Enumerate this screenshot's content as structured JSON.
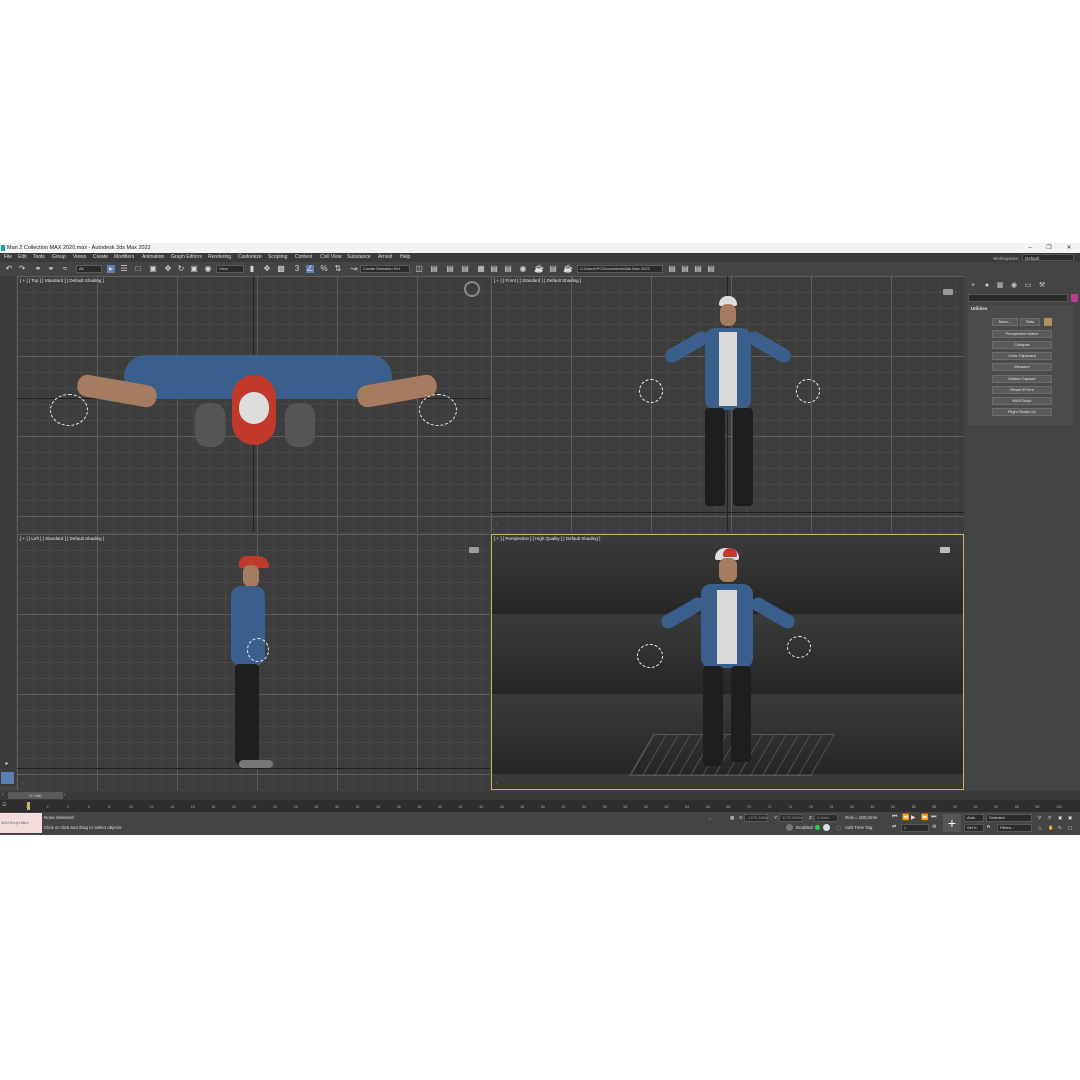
{
  "window": {
    "title": "Man 2 Collection MAX 2020.max - Autodesk 3ds Max 2022"
  },
  "menu": {
    "items": [
      "File",
      "Edit",
      "Tools",
      "Group",
      "Views",
      "Create",
      "Modifiers",
      "Animation",
      "Graph Editors",
      "Rendering",
      "Customize",
      "Scripting",
      "Content",
      "Civil View",
      "Substance",
      "Arnold",
      "Help"
    ]
  },
  "workspace": {
    "label": "Workspaces:",
    "value": "Default"
  },
  "toolbar": {
    "filter_value": "All",
    "refcoord_value": "View",
    "selection_set_placeholder": "Create Selection Set",
    "project_path": "C:\\Users\\PC\\Documents\\3ds Max 2022"
  },
  "viewports": {
    "top": {
      "label": "[ + ] [ Top ] [ Standard ] [ Default Shading ]"
    },
    "front": {
      "label": "[ + ] [ Front ] [ Standard ] [ Default Shading ]"
    },
    "left": {
      "label": "[ + ] [ Left ] [ Standard ] [ Default Shading ]"
    },
    "perspective": {
      "label": "[ + ] [ Perspective ] [ High Quality ] [ Default Shading ]"
    }
  },
  "command_panel": {
    "rollout_title": "Utilities",
    "more_button": "More...",
    "sets_button": "Sets",
    "utilities": [
      "Perspective Match",
      "Collapse",
      "Color Clipboard",
      "Measure",
      "Motion Capture",
      "Reset XForm",
      "MAXScript",
      "Flight Studio (c)"
    ]
  },
  "timeline": {
    "frame_display": "0 / 100",
    "ticks": [
      "0",
      "2",
      "4",
      "6",
      "8",
      "10",
      "12",
      "14",
      "16",
      "18",
      "20",
      "22",
      "24",
      "26",
      "28",
      "30",
      "32",
      "34",
      "36",
      "38",
      "40",
      "42",
      "44",
      "46",
      "48",
      "50",
      "52",
      "54",
      "56",
      "58",
      "60",
      "62",
      "64",
      "66",
      "68",
      "70",
      "72",
      "74",
      "76",
      "78",
      "80",
      "82",
      "84",
      "86",
      "88",
      "90",
      "92",
      "94",
      "96",
      "98",
      "100"
    ]
  },
  "status": {
    "maxscript_label": "MAXScript Mini",
    "selection_text": "None Selected",
    "prompt_text": "Click or click and drag to select objects",
    "x_label": "X:",
    "x_value": "-1370,469m",
    "y_label": "Y:",
    "y_value": "1270,069m",
    "z_label": "Z:",
    "z_value": "0,0mm",
    "grid_text": "Grid = 100,0mm",
    "enabled_label": "Enabled:",
    "add_time_tag": "Add Time Tag",
    "auto_label": "Auto",
    "selected_value": "Selected",
    "setk_label": "Set K.",
    "filters_label": "Filters...",
    "frame_value": "0"
  },
  "colors": {
    "ui_bg": "#444444",
    "viewport_bg": "#3d3d3d",
    "active_border": "#c9b560",
    "shirt": "#3a5f8c",
    "cap_red": "#c0392b",
    "pants": "#1e1e1e"
  }
}
